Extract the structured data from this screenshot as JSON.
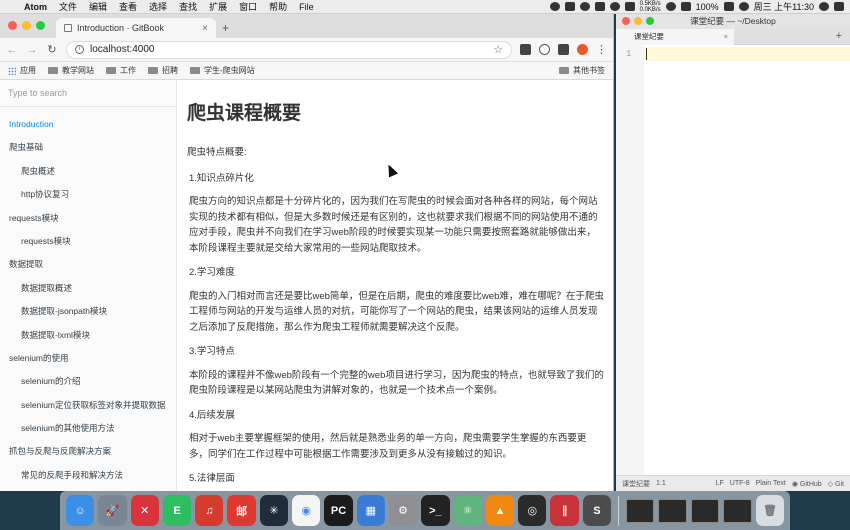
{
  "menubar": {
    "app": "Atom",
    "items": [
      "文件",
      "编辑",
      "查看",
      "选择",
      "查找",
      "扩展",
      "窗口",
      "帮助",
      "File"
    ],
    "net_up": "0.5KB/s",
    "net_down": "0.0KB/s",
    "battery": "100%",
    "clock": "周三 上午11:30"
  },
  "browser": {
    "tab_title": "Introduction · GitBook",
    "url": "localhost:4000",
    "bookmarks": [
      "应用",
      "教学网站",
      "工作",
      "招聘",
      "学生-爬虫网站"
    ],
    "other_bookmarks": "其他书签"
  },
  "sidebar": {
    "search_placeholder": "Type to search",
    "items": [
      {
        "label": "Introduction",
        "level": 0,
        "active": true
      },
      {
        "label": "爬虫基础",
        "level": 0
      },
      {
        "label": "爬虫概述",
        "level": 1
      },
      {
        "label": "http协议复习",
        "level": 1
      },
      {
        "label": "requests模块",
        "level": 0
      },
      {
        "label": "requests模块",
        "level": 1
      },
      {
        "label": "数据提取",
        "level": 0
      },
      {
        "label": "数据提取概述",
        "level": 1
      },
      {
        "label": "数据提取-jsonpath模块",
        "level": 1
      },
      {
        "label": "数据提取-lxml模块",
        "level": 1
      },
      {
        "label": "selenium的使用",
        "level": 0
      },
      {
        "label": "selenium的介绍",
        "level": 1
      },
      {
        "label": "selenium定位获取标签对象并提取数据",
        "level": 1
      },
      {
        "label": "selenium的其他使用方法",
        "level": 1
      },
      {
        "label": "抓包与反爬与反爬解决方案",
        "level": 0
      },
      {
        "label": "常见的反爬手段和解决方法",
        "level": 1
      }
    ]
  },
  "article": {
    "title": "爬虫课程概要",
    "lead": "爬虫特点概要:",
    "h1": "1.知识点碎片化",
    "p1": "爬虫方向的知识点都是十分碎片化的，因为我们在写爬虫的时候会面对各种各样的网站，每个网站实现的技术都有相似，但是大多数时候还是有区别的，这也就要求我们根据不同的网站使用不通的应对手段，爬虫并不向我们在学习web阶段的时候要实现某一功能只需要按照套路就能够做出来，本阶段课程主要就是交给大家常用的一些网站爬取技术。",
    "h2": "2.学习难度",
    "p2": "爬虫的入门相对而言还是要比web简单，但是在后期，爬虫的难度要比web难，难在哪呢？在于爬虫工程师与网站的开发与运维人员的对抗，可能你写了一个网站的爬虫，结果该网站的运维人员发现之后添加了反爬措施，那么作为爬虫工程师就需要解决这个反爬。",
    "h3": "3.学习特点",
    "p3": "本阶段的课程并不像web阶段有一个完整的web项目进行学习，因为爬虫的特点，也就导致了我们的爬虫阶段课程是以某网站爬虫为讲解对象的，也就是一个技术点一个案例。",
    "h4": "4.后续发展",
    "p4": "相对于web主要掌握框架的使用，然后就是熟悉业务的单一方向，爬虫需要学生掌握的东西要更多，同学们在工作过程中可能根据工作需要涉及到更多从没有接触过的知识。",
    "h5": "5.法律层面"
  },
  "atom": {
    "window_title": "课堂纪要 — ~/Desktop",
    "tab": "课堂纪要",
    "line_number": "1",
    "status_file": "课堂纪要",
    "status_pos": "1:1",
    "status_lf": "LF",
    "status_enc": "UTF-8",
    "status_grammar": "Plain Text",
    "status_github": "GitHub",
    "status_git": "Git"
  },
  "dock": {
    "apps": [
      {
        "name": "finder",
        "color": "#3d8fe6",
        "glyph": "☺"
      },
      {
        "name": "launchpad",
        "color": "#7a8696",
        "glyph": "🚀"
      },
      {
        "name": "xmind",
        "color": "#d9343c",
        "glyph": "✕"
      },
      {
        "name": "evernote",
        "color": "#2dbe60",
        "glyph": "E"
      },
      {
        "name": "netease-music",
        "color": "#d63b30",
        "glyph": "♫"
      },
      {
        "name": "mail-master",
        "color": "#e0392f",
        "glyph": "邮"
      },
      {
        "name": "xmind-zen",
        "color": "#1f2d3a",
        "glyph": "✳"
      },
      {
        "name": "chrome",
        "color": "#f5f5f5",
        "glyph": "◉"
      },
      {
        "name": "pycharm",
        "color": "#1b1b1b",
        "glyph": "PC"
      },
      {
        "name": "keynote",
        "color": "#3a7bd5",
        "glyph": "▦"
      },
      {
        "name": "system-preferences",
        "color": "#8e8e93",
        "glyph": "⚙"
      },
      {
        "name": "terminal",
        "color": "#222222",
        "glyph": ">_"
      },
      {
        "name": "atom",
        "color": "#5fb57d",
        "glyph": "⚛"
      },
      {
        "name": "vlc",
        "color": "#f08a12",
        "glyph": "▲"
      },
      {
        "name": "obs",
        "color": "#2b2b2b",
        "glyph": "◎"
      },
      {
        "name": "parallels",
        "color": "#c8323a",
        "glyph": "∥"
      },
      {
        "name": "sublime",
        "color": "#4c4c4c",
        "glyph": "S"
      }
    ],
    "thumbs": 4,
    "trash": "trash"
  }
}
